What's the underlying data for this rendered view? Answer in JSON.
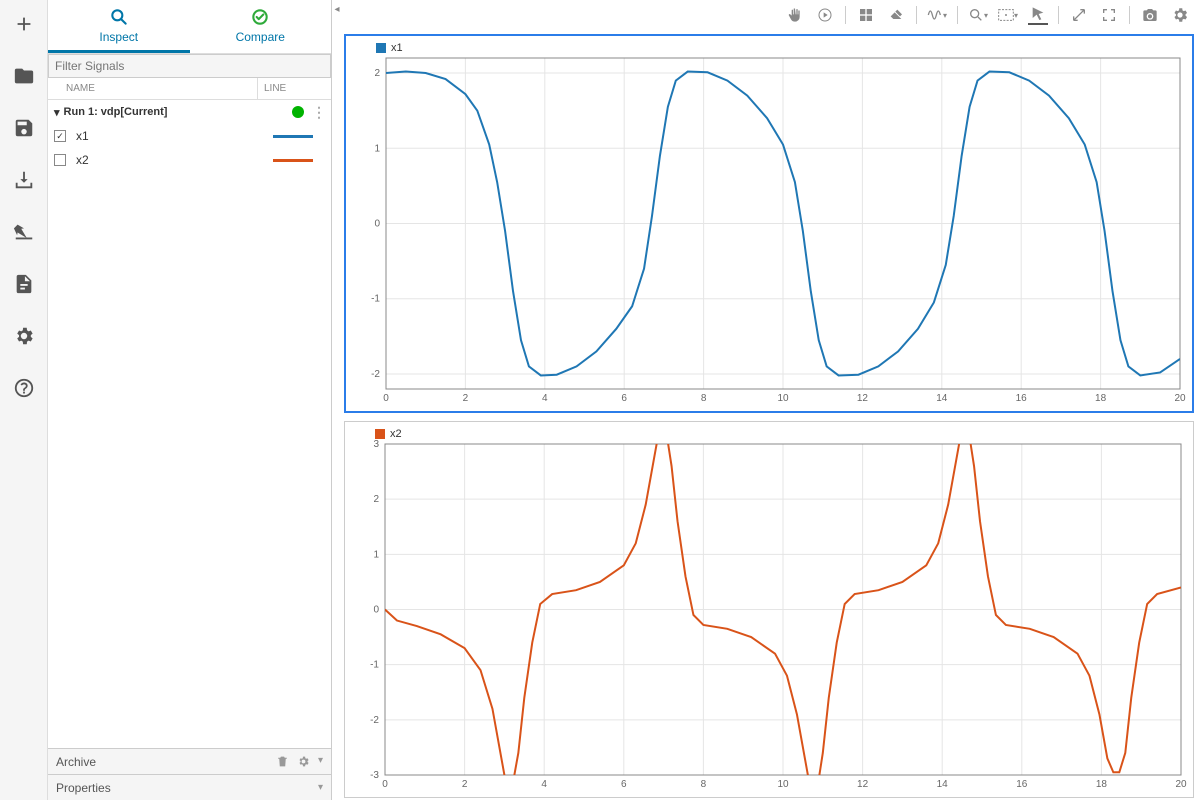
{
  "tabs": {
    "inspect": "Inspect",
    "compare": "Compare"
  },
  "filter_placeholder": "Filter Signals",
  "headers": {
    "name": "NAME",
    "line": "LINE"
  },
  "run": {
    "label": "Run 1: vdp[Current]"
  },
  "signals": [
    {
      "name": "x1",
      "checked": true,
      "color": "#1f77b4"
    },
    {
      "name": "x2",
      "checked": false,
      "color": "#d95319"
    }
  ],
  "archive_label": "Archive",
  "properties_label": "Properties",
  "chart_data": [
    {
      "type": "line",
      "title": "x1",
      "color": "#1f77b4",
      "xlim": [
        0,
        20
      ],
      "ylim": [
        -2.2,
        2.2
      ],
      "xticks": [
        0,
        2,
        4,
        6,
        8,
        10,
        12,
        14,
        16,
        18,
        20
      ],
      "yticks": [
        -2,
        -1,
        0,
        1,
        2
      ],
      "data": [
        [
          0,
          2.0
        ],
        [
          0.5,
          2.02
        ],
        [
          1,
          2.0
        ],
        [
          1.5,
          1.92
        ],
        [
          2,
          1.72
        ],
        [
          2.3,
          1.5
        ],
        [
          2.6,
          1.05
        ],
        [
          2.8,
          0.55
        ],
        [
          3.0,
          -0.1
        ],
        [
          3.2,
          -0.9
        ],
        [
          3.4,
          -1.55
        ],
        [
          3.6,
          -1.9
        ],
        [
          3.9,
          -2.02
        ],
        [
          4.3,
          -2.01
        ],
        [
          4.8,
          -1.9
        ],
        [
          5.3,
          -1.7
        ],
        [
          5.8,
          -1.4
        ],
        [
          6.2,
          -1.1
        ],
        [
          6.5,
          -0.6
        ],
        [
          6.7,
          0.1
        ],
        [
          6.9,
          0.9
        ],
        [
          7.1,
          1.55
        ],
        [
          7.3,
          1.9
        ],
        [
          7.6,
          2.02
        ],
        [
          8.1,
          2.01
        ],
        [
          8.6,
          1.9
        ],
        [
          9.1,
          1.7
        ],
        [
          9.6,
          1.4
        ],
        [
          10.0,
          1.05
        ],
        [
          10.3,
          0.55
        ],
        [
          10.5,
          -0.1
        ],
        [
          10.7,
          -0.9
        ],
        [
          10.9,
          -1.55
        ],
        [
          11.1,
          -1.9
        ],
        [
          11.4,
          -2.02
        ],
        [
          11.9,
          -2.01
        ],
        [
          12.4,
          -1.9
        ],
        [
          12.9,
          -1.7
        ],
        [
          13.4,
          -1.4
        ],
        [
          13.8,
          -1.05
        ],
        [
          14.1,
          -0.55
        ],
        [
          14.3,
          0.1
        ],
        [
          14.5,
          0.9
        ],
        [
          14.7,
          1.55
        ],
        [
          14.9,
          1.9
        ],
        [
          15.2,
          2.02
        ],
        [
          15.7,
          2.01
        ],
        [
          16.2,
          1.9
        ],
        [
          16.7,
          1.7
        ],
        [
          17.2,
          1.4
        ],
        [
          17.6,
          1.05
        ],
        [
          17.9,
          0.55
        ],
        [
          18.1,
          -0.1
        ],
        [
          18.3,
          -0.9
        ],
        [
          18.5,
          -1.55
        ],
        [
          18.7,
          -1.9
        ],
        [
          19.0,
          -2.02
        ],
        [
          19.5,
          -1.98
        ],
        [
          20,
          -1.8
        ]
      ]
    },
    {
      "type": "line",
      "title": "x2",
      "color": "#d95319",
      "xlim": [
        0,
        20
      ],
      "ylim": [
        -3,
        3
      ],
      "xticks": [
        0,
        2,
        4,
        6,
        8,
        10,
        12,
        14,
        16,
        18,
        20
      ],
      "yticks": [
        -3,
        -2,
        -1,
        0,
        1,
        2,
        3
      ],
      "data": [
        [
          0,
          0.0
        ],
        [
          0.3,
          -0.2
        ],
        [
          0.8,
          -0.3
        ],
        [
          1.4,
          -0.45
        ],
        [
          2.0,
          -0.7
        ],
        [
          2.4,
          -1.1
        ],
        [
          2.7,
          -1.8
        ],
        [
          2.9,
          -2.6
        ],
        [
          3.05,
          -3.2
        ],
        [
          3.2,
          -3.2
        ],
        [
          3.35,
          -2.6
        ],
        [
          3.5,
          -1.6
        ],
        [
          3.7,
          -0.6
        ],
        [
          3.9,
          0.1
        ],
        [
          4.2,
          0.28
        ],
        [
          4.8,
          0.35
        ],
        [
          5.4,
          0.5
        ],
        [
          6.0,
          0.8
        ],
        [
          6.3,
          1.2
        ],
        [
          6.55,
          1.9
        ],
        [
          6.75,
          2.7
        ],
        [
          6.9,
          3.3
        ],
        [
          7.05,
          3.3
        ],
        [
          7.2,
          2.6
        ],
        [
          7.35,
          1.6
        ],
        [
          7.55,
          0.6
        ],
        [
          7.75,
          -0.1
        ],
        [
          8.0,
          -0.28
        ],
        [
          8.6,
          -0.35
        ],
        [
          9.2,
          -0.5
        ],
        [
          9.8,
          -0.8
        ],
        [
          10.1,
          -1.2
        ],
        [
          10.35,
          -1.9
        ],
        [
          10.55,
          -2.7
        ],
        [
          10.7,
          -3.3
        ],
        [
          10.85,
          -3.3
        ],
        [
          11.0,
          -2.6
        ],
        [
          11.15,
          -1.6
        ],
        [
          11.35,
          -0.6
        ],
        [
          11.55,
          0.1
        ],
        [
          11.8,
          0.28
        ],
        [
          12.4,
          0.35
        ],
        [
          13.0,
          0.5
        ],
        [
          13.6,
          0.8
        ],
        [
          13.9,
          1.2
        ],
        [
          14.15,
          1.9
        ],
        [
          14.35,
          2.7
        ],
        [
          14.5,
          3.3
        ],
        [
          14.65,
          3.3
        ],
        [
          14.8,
          2.6
        ],
        [
          14.95,
          1.6
        ],
        [
          15.15,
          0.6
        ],
        [
          15.35,
          -0.1
        ],
        [
          15.6,
          -0.28
        ],
        [
          16.2,
          -0.35
        ],
        [
          16.8,
          -0.5
        ],
        [
          17.4,
          -0.8
        ],
        [
          17.7,
          -1.2
        ],
        [
          17.95,
          -1.9
        ],
        [
          18.15,
          -2.7
        ],
        [
          18.3,
          -2.95
        ],
        [
          18.45,
          -2.95
        ],
        [
          18.6,
          -2.6
        ],
        [
          18.75,
          -1.6
        ],
        [
          18.95,
          -0.6
        ],
        [
          19.15,
          0.1
        ],
        [
          19.4,
          0.28
        ],
        [
          20,
          0.4
        ]
      ]
    }
  ]
}
